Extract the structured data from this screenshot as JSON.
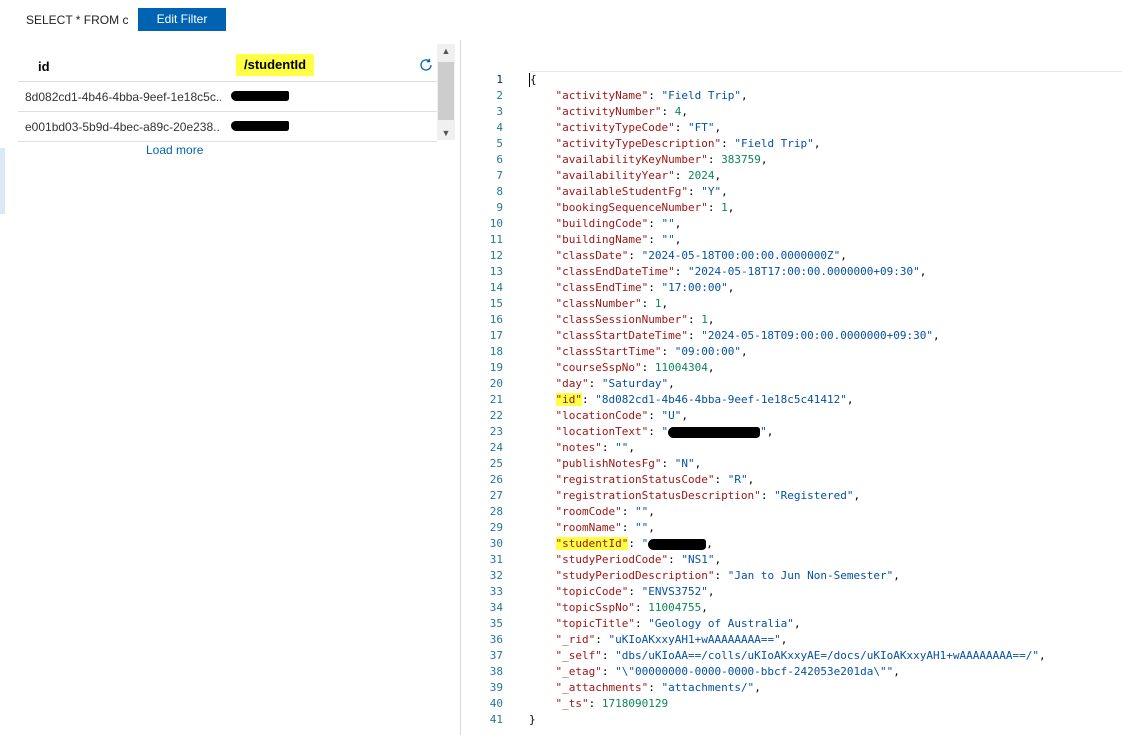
{
  "toolbar": {
    "query": "SELECT * FROM c",
    "edit_filter_label": "Edit Filter"
  },
  "grid": {
    "columns": [
      "id",
      "/studentId"
    ],
    "rows": [
      {
        "id": "8d082cd1-4b46-4bba-9eef-1e18c5c...",
        "studentId": ""
      },
      {
        "id": "e001bd03-5b9d-4bec-a89c-20e238...",
        "studentId": ""
      }
    ],
    "load_more": "Load more"
  },
  "editor": {
    "lines": [
      {
        "n": "1",
        "indent": "",
        "parts": [
          [
            "p",
            "{"
          ]
        ]
      },
      {
        "n": "2",
        "indent": "    ",
        "parts": [
          [
            "k",
            "\"activityName\""
          ],
          [
            "p",
            ": "
          ],
          [
            "s",
            "\"Field Trip\""
          ],
          [
            "p",
            ","
          ]
        ]
      },
      {
        "n": "3",
        "indent": "    ",
        "parts": [
          [
            "k",
            "\"activityNumber\""
          ],
          [
            "p",
            ": "
          ],
          [
            "n",
            "4"
          ],
          [
            "p",
            ","
          ]
        ]
      },
      {
        "n": "4",
        "indent": "    ",
        "parts": [
          [
            "k",
            "\"activityTypeCode\""
          ],
          [
            "p",
            ": "
          ],
          [
            "s",
            "\"FT\""
          ],
          [
            "p",
            ","
          ]
        ]
      },
      {
        "n": "5",
        "indent": "    ",
        "parts": [
          [
            "k",
            "\"activityTypeDescription\""
          ],
          [
            "p",
            ": "
          ],
          [
            "s",
            "\"Field Trip\""
          ],
          [
            "p",
            ","
          ]
        ]
      },
      {
        "n": "6",
        "indent": "    ",
        "parts": [
          [
            "k",
            "\"availabilityKeyNumber\""
          ],
          [
            "p",
            ": "
          ],
          [
            "n",
            "383759"
          ],
          [
            "p",
            ","
          ]
        ]
      },
      {
        "n": "7",
        "indent": "    ",
        "parts": [
          [
            "k",
            "\"availabilityYear\""
          ],
          [
            "p",
            ": "
          ],
          [
            "n",
            "2024"
          ],
          [
            "p",
            ","
          ]
        ]
      },
      {
        "n": "8",
        "indent": "    ",
        "parts": [
          [
            "k",
            "\"availableStudentFg\""
          ],
          [
            "p",
            ": "
          ],
          [
            "s",
            "\"Y\""
          ],
          [
            "p",
            ","
          ]
        ]
      },
      {
        "n": "9",
        "indent": "    ",
        "parts": [
          [
            "k",
            "\"bookingSequenceNumber\""
          ],
          [
            "p",
            ": "
          ],
          [
            "n",
            "1"
          ],
          [
            "p",
            ","
          ]
        ]
      },
      {
        "n": "10",
        "indent": "    ",
        "parts": [
          [
            "k",
            "\"buildingCode\""
          ],
          [
            "p",
            ": "
          ],
          [
            "s",
            "\"\""
          ],
          [
            "p",
            ","
          ]
        ]
      },
      {
        "n": "11",
        "indent": "    ",
        "parts": [
          [
            "k",
            "\"buildingName\""
          ],
          [
            "p",
            ": "
          ],
          [
            "s",
            "\"\""
          ],
          [
            "p",
            ","
          ]
        ]
      },
      {
        "n": "12",
        "indent": "    ",
        "parts": [
          [
            "k",
            "\"classDate\""
          ],
          [
            "p",
            ": "
          ],
          [
            "s",
            "\"2024-05-18T00:00:00.0000000Z\""
          ],
          [
            "p",
            ","
          ]
        ]
      },
      {
        "n": "13",
        "indent": "    ",
        "parts": [
          [
            "k",
            "\"classEndDateTime\""
          ],
          [
            "p",
            ": "
          ],
          [
            "s",
            "\"2024-05-18T17:00:00.0000000+09:30\""
          ],
          [
            "p",
            ","
          ]
        ]
      },
      {
        "n": "14",
        "indent": "    ",
        "parts": [
          [
            "k",
            "\"classEndTime\""
          ],
          [
            "p",
            ": "
          ],
          [
            "s",
            "\"17:00:00\""
          ],
          [
            "p",
            ","
          ]
        ]
      },
      {
        "n": "15",
        "indent": "    ",
        "parts": [
          [
            "k",
            "\"classNumber\""
          ],
          [
            "p",
            ": "
          ],
          [
            "n",
            "1"
          ],
          [
            "p",
            ","
          ]
        ]
      },
      {
        "n": "16",
        "indent": "    ",
        "parts": [
          [
            "k",
            "\"classSessionNumber\""
          ],
          [
            "p",
            ": "
          ],
          [
            "n",
            "1"
          ],
          [
            "p",
            ","
          ]
        ]
      },
      {
        "n": "17",
        "indent": "    ",
        "parts": [
          [
            "k",
            "\"classStartDateTime\""
          ],
          [
            "p",
            ": "
          ],
          [
            "s",
            "\"2024-05-18T09:00:00.0000000+09:30\""
          ],
          [
            "p",
            ","
          ]
        ]
      },
      {
        "n": "18",
        "indent": "    ",
        "parts": [
          [
            "k",
            "\"classStartTime\""
          ],
          [
            "p",
            ": "
          ],
          [
            "s",
            "\"09:00:00\""
          ],
          [
            "p",
            ","
          ]
        ]
      },
      {
        "n": "19",
        "indent": "    ",
        "parts": [
          [
            "k",
            "\"courseSspNo\""
          ],
          [
            "p",
            ": "
          ],
          [
            "n",
            "11004304"
          ],
          [
            "p",
            ","
          ]
        ]
      },
      {
        "n": "20",
        "indent": "    ",
        "parts": [
          [
            "k",
            "\"day\""
          ],
          [
            "p",
            ": "
          ],
          [
            "s",
            "\"Saturday\""
          ],
          [
            "p",
            ","
          ]
        ]
      },
      {
        "n": "21",
        "indent": "    ",
        "parts": [
          [
            "hk",
            "\"id\""
          ],
          [
            "p",
            ": "
          ],
          [
            "s",
            "\"8d082cd1-4b46-4bba-9eef-1e18c5c41412\""
          ],
          [
            "p",
            ","
          ]
        ]
      },
      {
        "n": "22",
        "indent": "    ",
        "parts": [
          [
            "k",
            "\"locationCode\""
          ],
          [
            "p",
            ": "
          ],
          [
            "s",
            "\"U\""
          ],
          [
            "p",
            ","
          ]
        ]
      },
      {
        "n": "23",
        "indent": "    ",
        "parts": [
          [
            "k",
            "\"locationText\""
          ],
          [
            "p",
            ": "
          ],
          [
            "s",
            "\""
          ],
          [
            "r",
            ""
          ],
          [
            "s",
            "\""
          ],
          [
            "p",
            ","
          ]
        ]
      },
      {
        "n": "24",
        "indent": "    ",
        "parts": [
          [
            "k",
            "\"notes\""
          ],
          [
            "p",
            ": "
          ],
          [
            "s",
            "\"\""
          ],
          [
            "p",
            ","
          ]
        ]
      },
      {
        "n": "25",
        "indent": "    ",
        "parts": [
          [
            "k",
            "\"publishNotesFg\""
          ],
          [
            "p",
            ": "
          ],
          [
            "s",
            "\"N\""
          ],
          [
            "p",
            ","
          ]
        ]
      },
      {
        "n": "26",
        "indent": "    ",
        "parts": [
          [
            "k",
            "\"registrationStatusCode\""
          ],
          [
            "p",
            ": "
          ],
          [
            "s",
            "\"R\""
          ],
          [
            "p",
            ","
          ]
        ]
      },
      {
        "n": "27",
        "indent": "    ",
        "parts": [
          [
            "k",
            "\"registrationStatusDescription\""
          ],
          [
            "p",
            ": "
          ],
          [
            "s",
            "\"Registered\""
          ],
          [
            "p",
            ","
          ]
        ]
      },
      {
        "n": "28",
        "indent": "    ",
        "parts": [
          [
            "k",
            "\"roomCode\""
          ],
          [
            "p",
            ": "
          ],
          [
            "s",
            "\"\""
          ],
          [
            "p",
            ","
          ]
        ]
      },
      {
        "n": "29",
        "indent": "    ",
        "parts": [
          [
            "k",
            "\"roomName\""
          ],
          [
            "p",
            ": "
          ],
          [
            "s",
            "\"\""
          ],
          [
            "p",
            ","
          ]
        ]
      },
      {
        "n": "30",
        "indent": "    ",
        "parts": [
          [
            "hk",
            "\"studentId\""
          ],
          [
            "p",
            ": "
          ],
          [
            "s",
            "\""
          ],
          [
            "rs",
            ""
          ],
          [
            "p",
            ","
          ]
        ]
      },
      {
        "n": "31",
        "indent": "    ",
        "parts": [
          [
            "k",
            "\"studyPeriodCode\""
          ],
          [
            "p",
            ": "
          ],
          [
            "s",
            "\"NS1\""
          ],
          [
            "p",
            ","
          ]
        ]
      },
      {
        "n": "32",
        "indent": "    ",
        "parts": [
          [
            "k",
            "\"studyPeriodDescription\""
          ],
          [
            "p",
            ": "
          ],
          [
            "s",
            "\"Jan to Jun Non-Semester\""
          ],
          [
            "p",
            ","
          ]
        ]
      },
      {
        "n": "33",
        "indent": "    ",
        "parts": [
          [
            "k",
            "\"topicCode\""
          ],
          [
            "p",
            ": "
          ],
          [
            "s",
            "\"ENVS3752\""
          ],
          [
            "p",
            ","
          ]
        ]
      },
      {
        "n": "34",
        "indent": "    ",
        "parts": [
          [
            "k",
            "\"topicSspNo\""
          ],
          [
            "p",
            ": "
          ],
          [
            "n",
            "11004755"
          ],
          [
            "p",
            ","
          ]
        ]
      },
      {
        "n": "35",
        "indent": "    ",
        "parts": [
          [
            "k",
            "\"topicTitle\""
          ],
          [
            "p",
            ": "
          ],
          [
            "s",
            "\"Geology of Australia\""
          ],
          [
            "p",
            ","
          ]
        ]
      },
      {
        "n": "36",
        "indent": "    ",
        "parts": [
          [
            "k",
            "\"_rid\""
          ],
          [
            "p",
            ": "
          ],
          [
            "s",
            "\"uKIoAKxxyAH1+wAAAAAAAA==\""
          ],
          [
            "p",
            ","
          ]
        ]
      },
      {
        "n": "37",
        "indent": "    ",
        "parts": [
          [
            "k",
            "\"_self\""
          ],
          [
            "p",
            ": "
          ],
          [
            "s",
            "\"dbs/uKIoAA==/colls/uKIoAKxxyAE=/docs/uKIoAKxxyAH1+wAAAAAAAA==/\""
          ],
          [
            "p",
            ","
          ]
        ]
      },
      {
        "n": "38",
        "indent": "    ",
        "parts": [
          [
            "k",
            "\"_etag\""
          ],
          [
            "p",
            ": "
          ],
          [
            "s",
            "\"\\\"00000000-0000-0000-bbcf-242053e201da\\\"\""
          ],
          [
            "p",
            ","
          ]
        ]
      },
      {
        "n": "39",
        "indent": "    ",
        "parts": [
          [
            "k",
            "\"_attachments\""
          ],
          [
            "p",
            ": "
          ],
          [
            "s",
            "\"attachments/\""
          ],
          [
            "p",
            ","
          ]
        ]
      },
      {
        "n": "40",
        "indent": "    ",
        "parts": [
          [
            "k",
            "\"_ts\""
          ],
          [
            "p",
            ": "
          ],
          [
            "n",
            "1718090129"
          ]
        ]
      },
      {
        "n": "41",
        "indent": "",
        "parts": [
          [
            "p",
            "}"
          ]
        ]
      }
    ]
  },
  "colors": {
    "accent": "#0063b1",
    "highlight": "#ffff44",
    "key": "#a31515",
    "string": "#0451a5",
    "number": "#098658"
  },
  "icons": {
    "refresh": "refresh-icon",
    "scroll_up": "chevron-up-icon",
    "scroll_down": "chevron-down-icon"
  }
}
